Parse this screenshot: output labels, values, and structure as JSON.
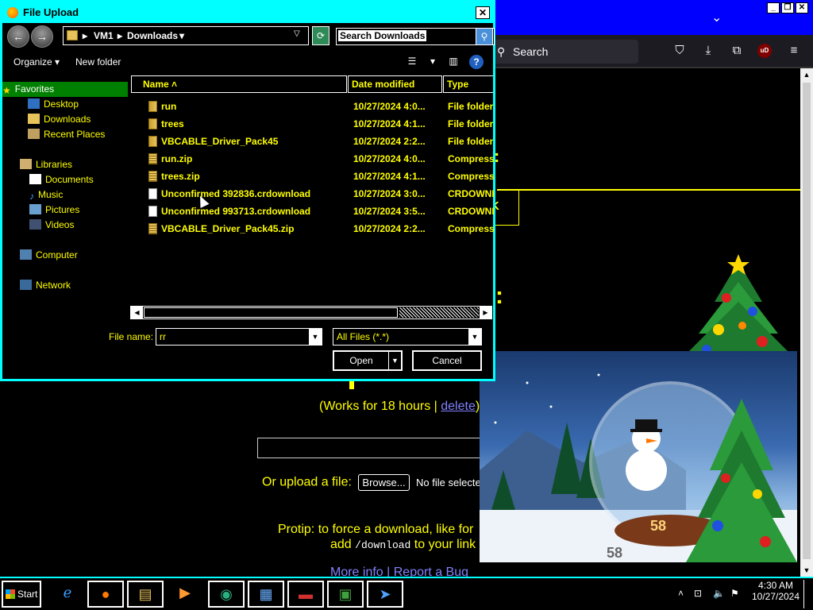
{
  "dialog": {
    "title": "File Upload",
    "close_label": "✕",
    "address": {
      "crumbs": [
        "VM1",
        "Downloads"
      ]
    },
    "search_placeholder": "Search Downloads",
    "commands": {
      "organize": "Organize",
      "new_folder": "New folder"
    },
    "nav": {
      "favorites": "Favorites",
      "desktop": "Desktop",
      "downloads": "Downloads",
      "recent": "Recent Places",
      "libraries": "Libraries",
      "documents": "Documents",
      "music": "Music",
      "pictures": "Pictures",
      "videos": "Videos",
      "computer": "Computer",
      "network": "Network"
    },
    "columns": {
      "name": "Name",
      "date": "Date modified",
      "type": "Type"
    },
    "files": [
      {
        "name": "run",
        "date": "10/27/2024 4:0...",
        "type": "File folder",
        "icon": "folder-icon"
      },
      {
        "name": "trees",
        "date": "10/27/2024 4:1...",
        "type": "File folder",
        "icon": "folder-icon"
      },
      {
        "name": "VBCABLE_Driver_Pack45",
        "date": "10/27/2024 2:2...",
        "type": "File folder",
        "icon": "folder-icon"
      },
      {
        "name": "run.zip",
        "date": "10/27/2024 4:0...",
        "type": "Compresse",
        "icon": "zip-icon"
      },
      {
        "name": "trees.zip",
        "date": "10/27/2024 4:1...",
        "type": "Compresse",
        "icon": "zip-icon"
      },
      {
        "name": "Unconfirmed 392836.crdownload",
        "date": "10/27/2024 3:0...",
        "type": "CRDOWNL",
        "icon": "document-icon"
      },
      {
        "name": "Unconfirmed 993713.crdownload",
        "date": "10/27/2024 3:5...",
        "type": "CRDOWNL",
        "icon": "document-icon"
      },
      {
        "name": "VBCABLE_Driver_Pack45.zip",
        "date": "10/27/2024 2:2...",
        "type": "Compresse",
        "icon": "zip-icon"
      }
    ],
    "file_name_label": "File name:",
    "file_name_value": "rr",
    "file_type_value": "All Files (*.*)",
    "open_label": "Open",
    "cancel_label": "Cancel"
  },
  "browser": {
    "search_placeholder": "Search",
    "ublock_label": "uD",
    "page": {
      "works_prefix": "(Works for 18 hours | ",
      "works_link": "delete",
      "works_suffix": ")",
      "upload_label": "Or upload a file:",
      "browse_label": "Browse...",
      "no_file": "No file selected.",
      "protip_line1": "Protip: to force a download, like for",
      "protip_line2_pre": "add ",
      "protip_code": "/download",
      "protip_line2_post": " to your link",
      "more_info": "More info | Report a Bug"
    }
  },
  "widget": {
    "counter": "58"
  },
  "taskbar": {
    "start_label": "Start",
    "time": "4:30 AM",
    "date": "10/27/2024"
  },
  "colors": {
    "dialog_border": "#00ffff",
    "text": "#ffff00",
    "selected": "#008000",
    "titlebar": "#0000ff"
  }
}
